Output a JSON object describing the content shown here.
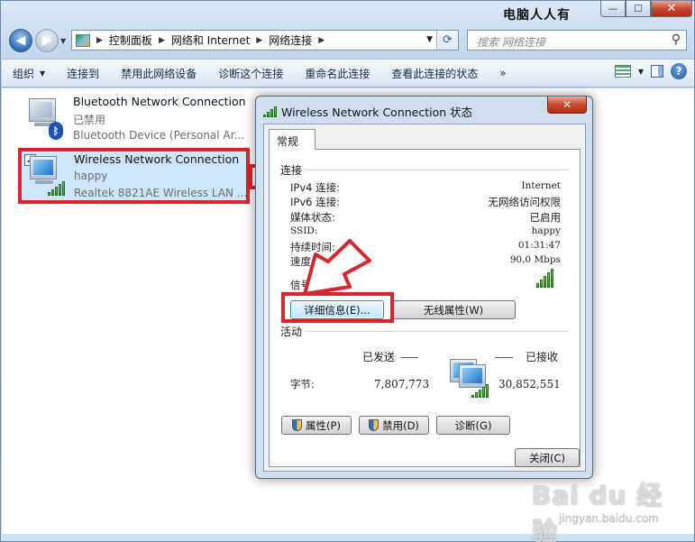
{
  "window": {
    "title": "电脑人人有",
    "controls": {
      "minimize": "—",
      "maximize": "☐",
      "close": "✕"
    }
  },
  "nav": {
    "back": "◀",
    "forward": "▶",
    "breadcrumbs": [
      "控制面板",
      "网络和 Internet",
      "网络连接"
    ],
    "search_placeholder": "搜索 网络连接"
  },
  "toolbar": {
    "organize": "组织",
    "items": [
      "连接到",
      "禁用此网络设备",
      "诊断这个连接",
      "重命名此连接",
      "查看此连接的状态"
    ],
    "more": "»",
    "help": "?"
  },
  "connections": [
    {
      "name": "Bluetooth Network Connection",
      "status": "已禁用",
      "device": "Bluetooth Device (Personal Ar..."
    },
    {
      "name": "Wireless Network Connection",
      "status": "happy",
      "device": "Realtek 8821AE Wireless LAN ..."
    }
  ],
  "dialog": {
    "title": "Wireless Network Connection 状态",
    "close": "✕",
    "tab": "常规",
    "connection_group": "连接",
    "rows": [
      {
        "k": "IPv4 连接:",
        "v": "Internet"
      },
      {
        "k": "IPv6 连接:",
        "v": "无网络访问权限"
      },
      {
        "k": "媒体状态:",
        "v": "已启用"
      },
      {
        "k": "SSID:",
        "v": "happy"
      },
      {
        "k": "持续时间:",
        "v": "01:31:47"
      },
      {
        "k": "速度:",
        "v": "90.0 Mbps"
      }
    ],
    "signal_label": "信号质量:",
    "signal_level": 5,
    "details_button": "详细信息(E)...",
    "wireless_props_button": "无线属性(W)",
    "activity_group": "活动",
    "sent_label": "已发送",
    "received_label": "已接收",
    "bytes_label": "字节:",
    "bytes_sent": "7,807,773",
    "bytes_received": "30,852,551",
    "properties_button": "属性(P)",
    "disable_button": "禁用(D)",
    "diagnose_button": "诊断(G)",
    "close_button": "关闭(C)"
  },
  "watermark": {
    "brand": "Bai du 经验",
    "url": "jingyan.baidu.com"
  },
  "colors": {
    "highlight": "#d9262c",
    "selection": "#cde6fb",
    "signal": "#2c9a22"
  }
}
